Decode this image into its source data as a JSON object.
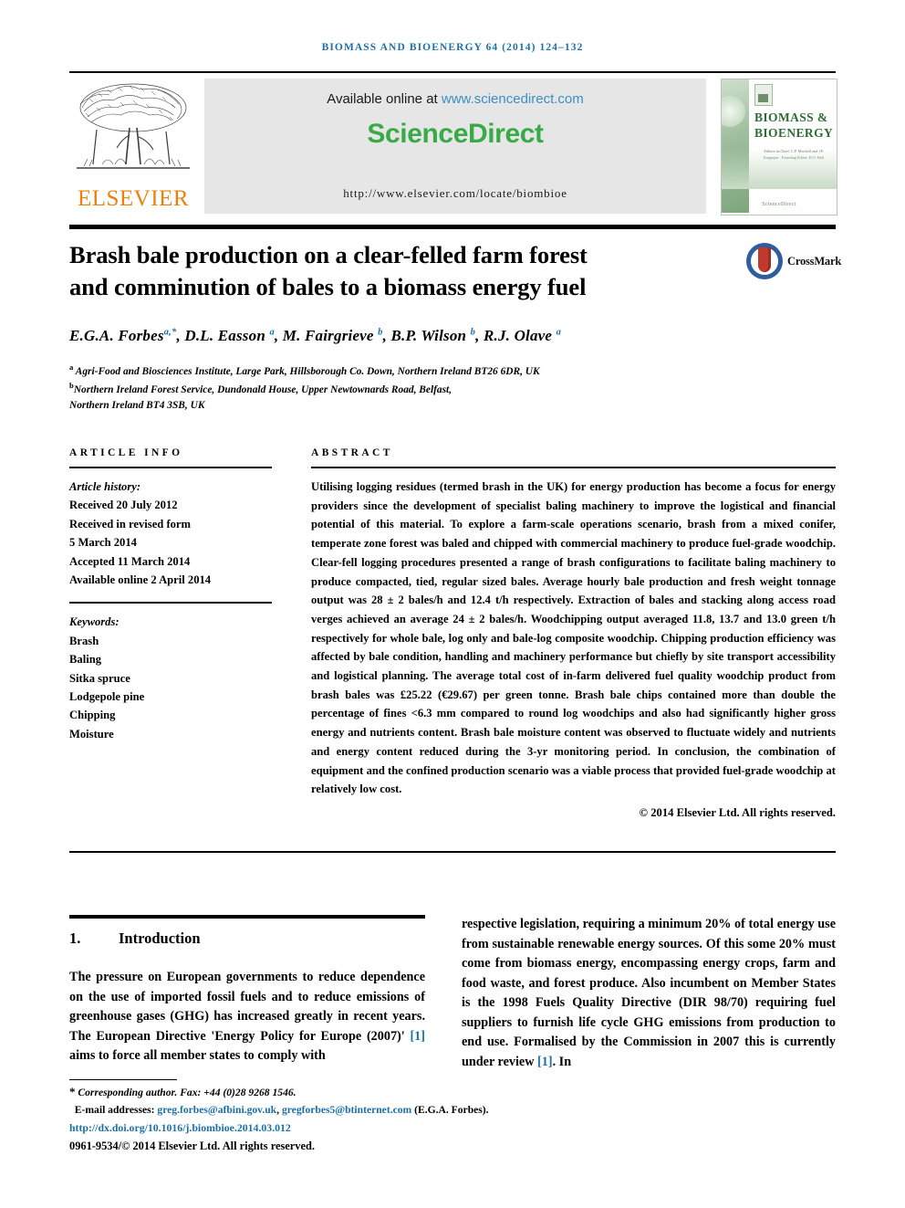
{
  "running_head": "Biomass and Bioenergy 64 (2014) 124–132",
  "masthead": {
    "available_prefix": "Available online at ",
    "sciencedirect_url": "www.sciencedirect.com",
    "sciencedirect_logo": "ScienceDirect",
    "journal_homepage": "http://www.elsevier.com/locate/biombioe",
    "publisher": "ELSEVIER",
    "cover": {
      "title_line1": "BIOMASS &",
      "title_line2": "BIOENERGY",
      "subtitle": "Editors-in-Chief: C.P. Mitchell and J.P. Koppejan · Founding Editor: D.O. Hall",
      "footer": "ScienceDirect"
    }
  },
  "crossmark": {
    "label": "CrossMark"
  },
  "article": {
    "title_line1": "Brash bale production on a clear-felled farm forest",
    "title_line2": "and comminution of bales to a biomass energy fuel",
    "authors_html": "E.G.A. Forbes<sup>a,*</sup>, D.L. Easson <sup>a</sup>, M. Fairgrieve <sup>b</sup>, B.P. Wilson <sup>b</sup>, R.J. Olave <sup>a</sup>",
    "affiliation_a": "Agri-Food and Biosciences Institute, Large Park, Hillsborough Co. Down, Northern Ireland BT26 6DR, UK",
    "affiliation_b_line1": "Northern Ireland Forest Service, Dundonald House, Upper Newtownards Road, Belfast,",
    "affiliation_b_line2": "Northern Ireland BT4 3SB, UK"
  },
  "article_info": {
    "heading": "ARTICLE INFO",
    "history_label": "Article history:",
    "history": [
      "Received 20 July 2012",
      "Received in revised form",
      "5 March 2014",
      "Accepted 11 March 2014",
      "Available online 2 April 2014"
    ],
    "keywords_label": "Keywords:",
    "keywords": [
      "Brash",
      "Baling",
      "Sitka spruce",
      "Lodgepole pine",
      "Chipping",
      "Moisture"
    ]
  },
  "abstract": {
    "heading": "ABSTRACT",
    "text": "Utilising logging residues (termed brash in the UK) for energy production has become a focus for energy providers since the development of specialist baling machinery to improve the logistical and financial potential of this material. To explore a farm-scale operations scenario, brash from a mixed conifer, temperate zone forest was baled and chipped with commercial machinery to produce fuel-grade woodchip. Clear-fell logging procedures presented a range of brash configurations to facilitate baling machinery to produce compacted, tied, regular sized bales. Average hourly bale production and fresh weight tonnage output was 28 ± 2 bales/h and 12.4 t/h respectively. Extraction of bales and stacking along access road verges achieved an average 24 ± 2 bales/h. Woodchipping output averaged 11.8, 13.7 and 13.0 green t/h respectively for whole bale, log only and bale-log composite woodchip. Chipping production efficiency was affected by bale condition, handling and machinery performance but chiefly by site transport accessibility and logistical planning. The average total cost of in-farm delivered fuel quality woodchip product from brash bales was £25.22 (€29.67) per green tonne. Brash bale chips contained more than double the percentage of fines <6.3 mm compared to round log woodchips and also had significantly higher gross energy and nutrients content. Brash bale moisture content was observed to fluctuate widely and nutrients and energy content reduced during the 3-yr monitoring period. In conclusion, the combination of equipment and the confined production scenario was a viable process that provided fuel-grade woodchip at relatively low cost.",
    "copyright": "© 2014 Elsevier Ltd. All rights reserved."
  },
  "introduction": {
    "number": "1.",
    "heading": "Introduction",
    "left_paragraph_html": "The pressure on European governments to reduce dependence on the use of imported fossil fuels and to reduce emissions of greenhouse gases (GHG) has increased greatly in recent years. The European Directive 'Energy Policy for Europe (2007)' <span class=\"ref\">[1]</span> aims to force all member states to comply with",
    "right_paragraph_html": "respective legislation, requiring a minimum 20% of total energy use from sustainable renewable energy sources. Of this some 20% must come from biomass energy, encompassing energy crops, farm and food waste, and forest produce. Also incumbent on Member States is the 1998 Fuels Quality Directive (DIR 98/70) requiring fuel suppliers to furnish life cycle GHG emissions from production to end use. Formalised by the Commission in 2007 this is currently under review <span class=\"ref\">[1]</span>. In"
  },
  "footer": {
    "corresponding": "Corresponding author. Fax: +44 (0)28 9268 1546.",
    "email_label": "E-mail addresses:",
    "email1": "greg.forbes@afbini.gov.uk",
    "email2": "gregforbes5@btinternet.com",
    "email_owner": "(E.G.A. Forbes).",
    "doi": "http://dx.doi.org/10.1016/j.biombioe.2014.03.012",
    "issn_line": "0961-9534/© 2014 Elsevier Ltd. All rights reserved."
  },
  "colors": {
    "link_blue": "#1c6fa8",
    "sciencedirect_green": "#3aaa49",
    "elsevier_orange": "#e8820c",
    "band_grey": "#e6e6e6"
  }
}
